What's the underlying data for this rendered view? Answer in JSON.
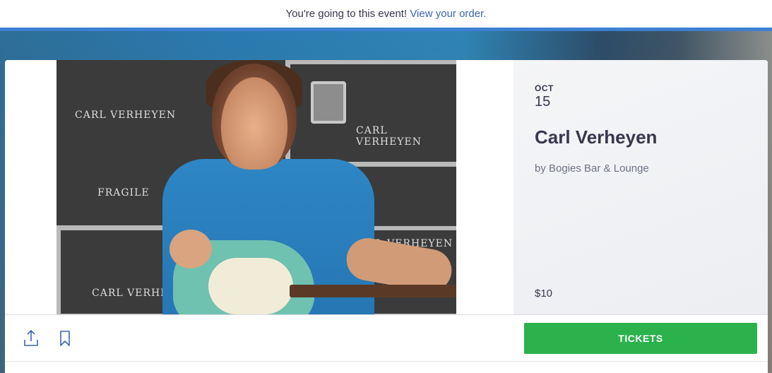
{
  "notice": {
    "text": "You're going to this event!",
    "link": "View your order."
  },
  "event": {
    "month": "OCT",
    "day": "15",
    "title": "Carl Verheyen",
    "organizer": "by Bogies Bar & Lounge",
    "price": "$10"
  },
  "photo": {
    "stencils": [
      "CARL VERHEYEN",
      "CARL VERHEYEN",
      "FRAGILE",
      "CARL VERHEYEN",
      "CARL VERHEY"
    ]
  },
  "actions": {
    "share_icon": "share-icon",
    "save_icon": "bookmark-icon",
    "tickets_label": "TICKETS"
  },
  "colors": {
    "accent": "#3d80d2",
    "link": "#3d64b2",
    "tickets": "#2bb24c",
    "text": "#39364f"
  }
}
